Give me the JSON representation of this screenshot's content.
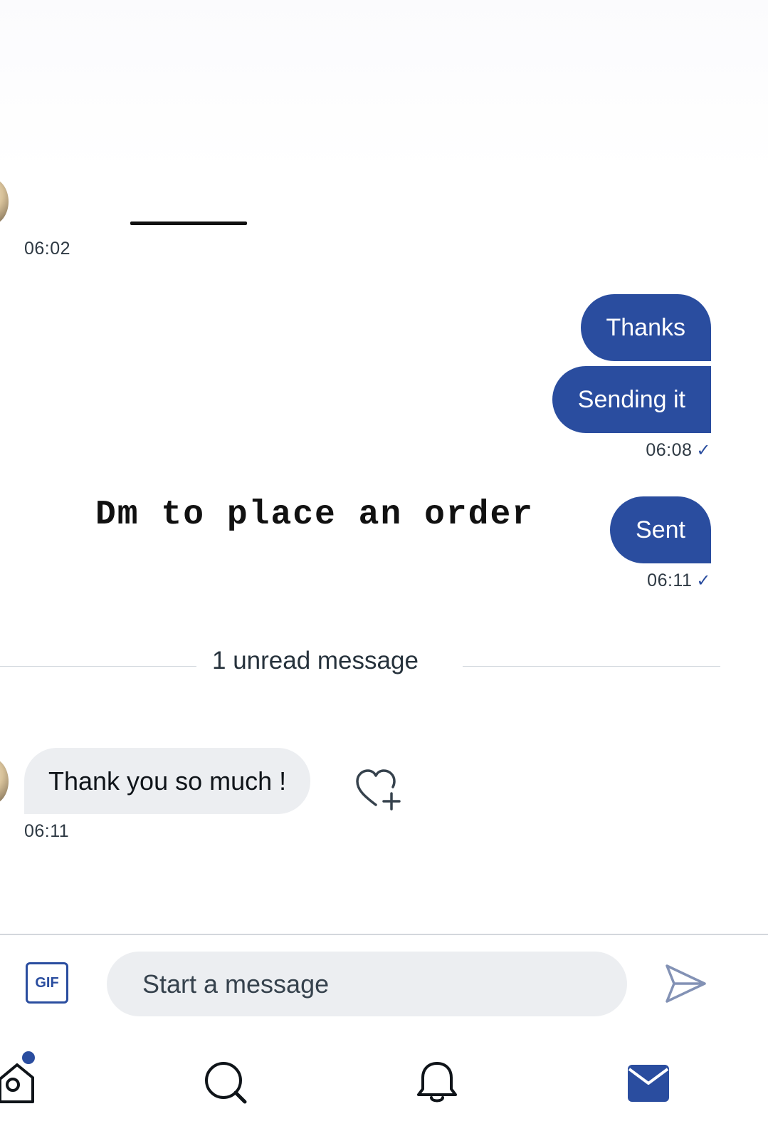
{
  "theme": {
    "accent": "#2a4d9f",
    "incoming_bubble": "#eceef1",
    "text": "#0f1419"
  },
  "conversation": {
    "first_timestamp": "06:02",
    "outgoing_group_1": {
      "messages": [
        "Thanks",
        "Sending it"
      ],
      "timestamp": "06:08",
      "status_icon": "check-icon"
    },
    "overlay_caption": "Dm to place an order",
    "outgoing_group_2": {
      "messages": [
        "Sent"
      ],
      "timestamp": "06:11",
      "status_icon": "check-icon"
    },
    "unread_divider": "1 unread message",
    "incoming": {
      "message": "Thank you so much !",
      "timestamp": "06:11",
      "reaction_icon": "heart-plus-icon"
    },
    "check_glyph": "✓"
  },
  "composer": {
    "gif_label": "GIF",
    "placeholder": "Start a message",
    "send_icon": "send-icon"
  },
  "bottom_nav": {
    "items": [
      "home-icon",
      "search-icon",
      "bell-icon",
      "mail-icon"
    ],
    "active": "mail-icon",
    "home_has_notification": true
  }
}
